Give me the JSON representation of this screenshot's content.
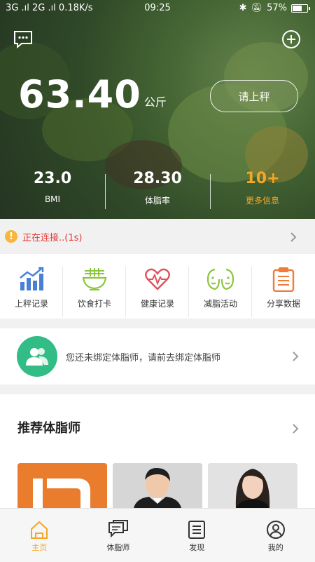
{
  "status": {
    "network": "3G .ıl 2G .ıl 0.18K/s",
    "time": "09:25",
    "battery": "57%"
  },
  "hero": {
    "weight_value": "63.40",
    "weight_unit": "公斤",
    "weigh_button": "请上秤",
    "stats": [
      {
        "value": "23.0",
        "label": "BMI"
      },
      {
        "value": "28.30",
        "label": "体脂率"
      },
      {
        "value": "10+",
        "label": "更多信息"
      }
    ]
  },
  "connection": {
    "text": "正在连接..(1s)",
    "icon": "warning-icon"
  },
  "quick_actions": [
    {
      "label": "上秤记录",
      "icon": "bar-chart-icon",
      "color": "#4a7fd6"
    },
    {
      "label": "饮食打卡",
      "icon": "bowl-icon",
      "color": "#8cc63e"
    },
    {
      "label": "健康记录",
      "icon": "heart-pulse-icon",
      "color": "#e0505b"
    },
    {
      "label": "减脂活动",
      "icon": "faces-icon",
      "color": "#8cc63e"
    },
    {
      "label": "分享数据",
      "icon": "clipboard-icon",
      "color": "#f07b3a"
    }
  ],
  "coach_bind": {
    "text": "您还未绑定体脂师，请前去绑定体脂师"
  },
  "recommend": {
    "title": "推荐体脂师"
  },
  "tabs": [
    {
      "label": "主页",
      "icon": "home-icon",
      "active": true
    },
    {
      "label": "体脂师",
      "icon": "chat-icon",
      "active": false
    },
    {
      "label": "发现",
      "icon": "list-icon",
      "active": false
    },
    {
      "label": "我的",
      "icon": "user-icon",
      "active": false
    }
  ],
  "colors": {
    "accent": "#f5a623",
    "warning_text": "#e53935",
    "coach_green": "#33bd86"
  }
}
